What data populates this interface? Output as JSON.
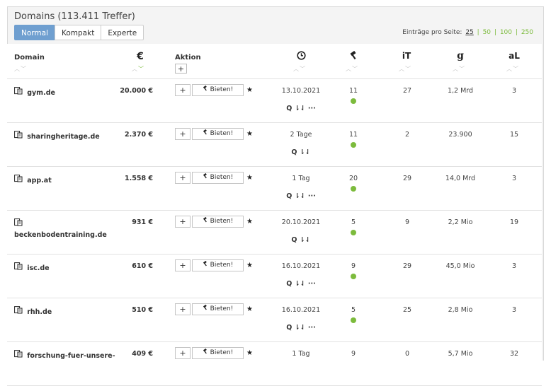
{
  "title": "Domains (113.411 Treffer)",
  "view_tabs": [
    "Normal",
    "Kompakt",
    "Experte"
  ],
  "per_page": {
    "label": "Einträge pro Seite:",
    "options": [
      "25",
      "50",
      "100",
      "250"
    ],
    "selected": "25"
  },
  "columns": {
    "domain": "Domain",
    "price_icon": "€",
    "action": "Aktion",
    "time_icon": "clock-icon",
    "bids_icon": "gavel-icon",
    "it_icon": "iT",
    "google_icon": "g",
    "al_icon": "aL"
  },
  "buttons": {
    "add": "+",
    "bid": "Bieten!"
  },
  "rows": [
    {
      "domain": "gym.de",
      "price": "20.000 €",
      "time": "13.10.2021",
      "bids": "11",
      "it": "27",
      "google": "1,2 Mrd",
      "al": "3",
      "tools": "Q ⇂⇃ ···",
      "dot": true
    },
    {
      "domain": "sharingheritage.de",
      "price": "2.370 €",
      "time": "2 Tage",
      "bids": "11",
      "it": "2",
      "google": "23.900",
      "al": "15",
      "tools": "Q ⇂⇃",
      "dot": true
    },
    {
      "domain": "app.at",
      "price": "1.558 €",
      "time": "1 Tag",
      "bids": "20",
      "it": "29",
      "google": "14,0 Mrd",
      "al": "3",
      "tools": "Q ⇂⇃ ···",
      "dot": true
    },
    {
      "domain": "beckenbodentraining.de",
      "price": "931 €",
      "time": "20.10.2021",
      "bids": "5",
      "it": "9",
      "google": "2,2 Mio",
      "al": "19",
      "tools": "Q ⇂⇃",
      "dot": true
    },
    {
      "domain": "isc.de",
      "price": "610 €",
      "time": "16.10.2021",
      "bids": "9",
      "it": "29",
      "google": "45,0 Mio",
      "al": "3",
      "tools": "Q ⇂⇃ ···",
      "dot": true
    },
    {
      "domain": "rhh.de",
      "price": "510 €",
      "time": "16.10.2021",
      "bids": "5",
      "it": "25",
      "google": "2,8 Mio",
      "al": "3",
      "tools": "Q ⇂⇃ ···",
      "dot": true
    },
    {
      "domain": "forschung-fuer-unsere-",
      "price": "409 €",
      "time": "1 Tag",
      "bids": "9",
      "it": "0",
      "google": "5,7 Mio",
      "al": "32",
      "tools": "",
      "dot": false
    }
  ]
}
